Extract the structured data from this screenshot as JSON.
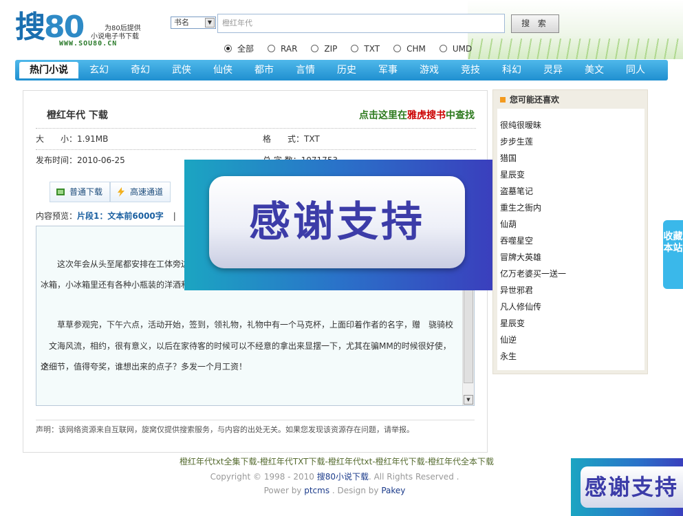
{
  "header": {
    "logo_text": "搜",
    "logo_num": "80",
    "logo_url": "WWW.SOU80.CN",
    "tagline_1": "为80后提供",
    "tagline_2": "小说电子书下载"
  },
  "search": {
    "select_value": "书名",
    "input_value": "橙红年代",
    "button_label": "搜 索",
    "formats": [
      {
        "label": "全部",
        "checked": true
      },
      {
        "label": "RAR",
        "checked": false
      },
      {
        "label": "ZIP",
        "checked": false
      },
      {
        "label": "TXT",
        "checked": false
      },
      {
        "label": "CHM",
        "checked": false
      },
      {
        "label": "UMD",
        "checked": false
      }
    ]
  },
  "nav": {
    "items": [
      "热门小说",
      "玄幻",
      "奇幻",
      "武侠",
      "仙侠",
      "都市",
      "言情",
      "历史",
      "军事",
      "游戏",
      "竞技",
      "科幻",
      "灵异",
      "美文",
      "同人"
    ]
  },
  "book": {
    "title": "橙红年代  下载",
    "find_prefix": "点击这里在",
    "find_highlight": "雅虎搜书",
    "find_suffix": "中查找",
    "size_label": "大　　小：",
    "size_value": "1.91MB",
    "format_label": "格　　式：",
    "format_value": "TXT",
    "date_label": "发布时间：",
    "date_value": "2010-06-25",
    "words_label": "总 字 数：",
    "words_value": "1071753",
    "normal_download": "普通下载",
    "fast_download": "高速通道",
    "preview_label": "内容预览：",
    "preview_segment": "片段1：文本前6000字",
    "preview_sep": "|",
    "preview_p1a": "　　这次年会从头至尾都安排在工体旁边",
    "preview_p1b": "冰箱，小冰箱里还有各种小瓶装的洋酒和",
    "preview_p2a": "　　草草参观完，下午六点，活动开始，签到，领礼物，礼物中有一个马克杯，上面印着作者的名字，赠　骁骑校",
    "preview_p2b": "　文海风流，相约，很有意义，以后在家待客的时候可以不经意的拿出来显摆一下，尤其在骗MM的时候很好使，这",
    "preview_p2c": "个细节，值得夸奖，谁想出来的点子？多发一个月工资！",
    "disclaimer": "声明：该网络资源来自互联网，旋窝仅提供搜索服务，与内容的出处无关。如果您发现该资源存在问题，请举报。"
  },
  "sidebar": {
    "title": "您可能还喜欢",
    "items": [
      "很纯很暧昧",
      "步步生莲",
      "猎国",
      "星辰变",
      "盗墓笔记",
      "重生之衙内",
      "仙葫",
      "吞噬星空",
      "冒牌大英雄",
      "亿万老婆买一送一",
      "异世邪君",
      "凡人修仙传",
      "星辰变",
      "仙逆",
      "永生"
    ]
  },
  "favorite": "收藏本站",
  "footer": {
    "links": "橙红年代txt全集下载-橙红年代TXT下载-橙红年代txt-橙红年代下载-橙红年代全本下载",
    "copy_prefix": "Copyright © 1998 - 2010 ",
    "copy_site": "搜80小说下载",
    "copy_suffix": ". All Rights Reserved .",
    "power_prefix": "Power by ",
    "power_tool": "ptcms",
    "power_mid": " . Design by ",
    "power_designer": "Pakey"
  },
  "overlay": {
    "banner_text": "感谢支持",
    "banner_small_text": "感谢支持"
  },
  "colors": {
    "nav_blue": "#1f8fd0",
    "find_green": "#2d7a1e",
    "find_red": "#c00000",
    "banner_text": "#3c3ca8"
  }
}
